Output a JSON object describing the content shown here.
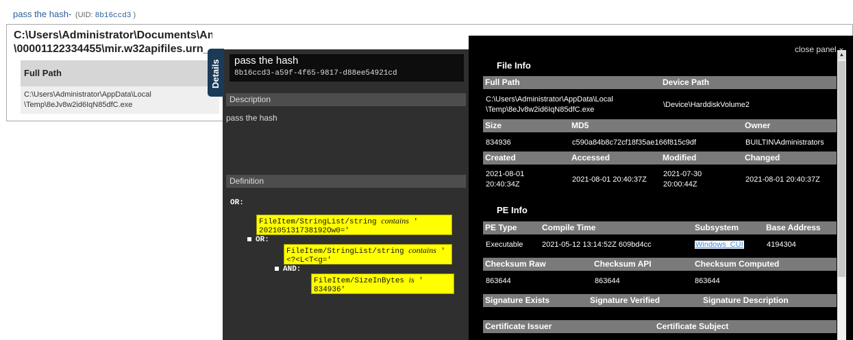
{
  "page": {
    "title": "pass the hash-",
    "uid_label": "(UID:",
    "uid_value": "8b16ccd3",
    "uid_close": ")",
    "report_path_line1": "C:\\Users\\Administrator\\Documents\\Analysis\\Sessions\\AnalysisSession1\\Audits\\Audits_Copy\\FerlocReport",
    "report_path_line2": "\\00001122334455\\mir.w32apifiles.urn_",
    "table_header": "Full Path",
    "table_value_line1": "C:\\Users\\Administrator\\AppData\\Local",
    "table_value_line2": "\\Temp\\8eJv8w2id6IqN85dfC.exe"
  },
  "details_tab": {
    "label": "Details"
  },
  "indicator": {
    "title": "pass the hash",
    "uid": "8b16ccd3-a59f-4f65-9817-d88ee54921cd",
    "description_label": "Description",
    "description_text": "pass the hash",
    "definition_label": "Definition",
    "definition": {
      "or1": "OR:",
      "cond1_path": "FileItem/StringList/string",
      "cond1_op": "contains",
      "cond1_val_a": "'",
      "cond1_val_b": "202105131738192Ow0='",
      "or2": "OR:",
      "cond2_path": "FileItem/StringList/string",
      "cond2_op": "contains",
      "cond2_val_a": "'",
      "cond2_val_b": "<?<L<T<g='",
      "and1": "AND:",
      "cond3_path": "FileItem/SizeInBytes",
      "cond3_op": "is",
      "cond3_val_a": "'",
      "cond3_val_b": "834936'"
    }
  },
  "details": {
    "close_label": "close panel",
    "file_info_title": "File Info",
    "full_path_label": "Full Path",
    "device_path_label": "Device Path",
    "full_path_line1": "C:\\Users\\Administrator\\AppData\\Local",
    "full_path_line2": "\\Temp\\8eJv8w2id6IqN85dfC.exe",
    "device_path": "\\Device\\HarddiskVolume2",
    "size_label": "Size",
    "md5_label": "MD5",
    "owner_label": "Owner",
    "size": "834936",
    "md5": "c590a84b8c72cf18f35ae166f815c9df",
    "owner": "BUILTIN\\Administrators",
    "created_label": "Created",
    "accessed_label": "Accessed",
    "modified_label": "Modified",
    "changed_label": "Changed",
    "created_line1": "2021-08-01",
    "created_line2": "20:40:34Z",
    "accessed": "2021-08-01 20:40:37Z",
    "modified_line1": "2021-07-30",
    "modified_line2": "20:00:44Z",
    "changed": "2021-08-01 20:40:37Z",
    "pe_info_title": "PE Info",
    "pe_type_label": "PE Type",
    "compile_time_label": "Compile Time",
    "subsystem_label": "Subsystem",
    "base_address_label": "Base Address",
    "pe_type": "Executable",
    "compile_time": "2021-05-12 13:14:52Z 609bd4cc",
    "subsystem": "Windows_CUI",
    "base_address": "4194304",
    "checksum_raw_label": "Checksum Raw",
    "checksum_api_label": "Checksum API",
    "checksum_computed_label": "Checksum Computed",
    "checksum_raw": "863644",
    "checksum_api": "863644",
    "checksum_computed": "863644",
    "sig_exists_label": "Signature Exists",
    "sig_verified_label": "Signature Verified",
    "sig_description_label": "Signature Description",
    "cert_issuer_label": "Certificate Issuer",
    "cert_subject_label": "Certificate Subject"
  },
  "colors": {
    "definition_highlight": "#ffff00",
    "header_bar": "#7a7a7a",
    "link": "#3b8ee8",
    "tab": "#1b3a57"
  },
  "icons": {
    "scroll_up": "scroll-up-arrow-icon"
  }
}
